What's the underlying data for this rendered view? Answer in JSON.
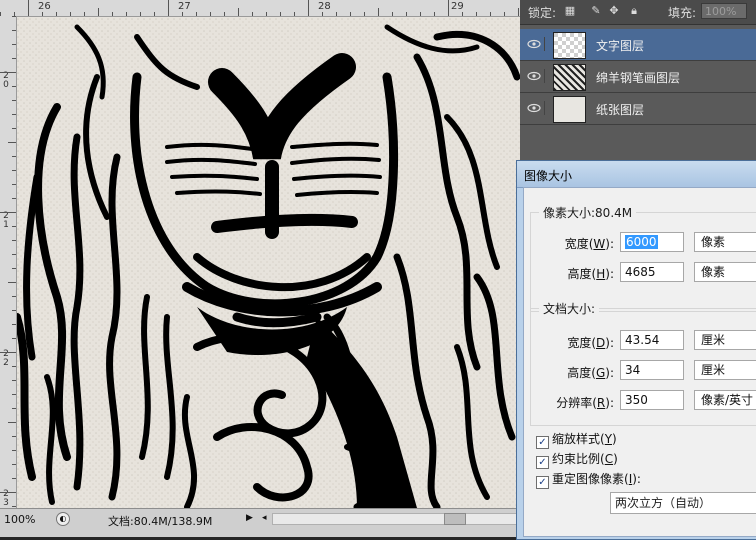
{
  "ruler": {
    "top_labels": [
      "26",
      "27",
      "28",
      "29"
    ],
    "left_labels": [
      [
        "2",
        "0"
      ],
      [
        "2",
        "1"
      ],
      [
        "2",
        "2"
      ],
      [
        "2",
        "3"
      ]
    ]
  },
  "status": {
    "zoom": "100%",
    "doc": "文档:80.4M/138.9M"
  },
  "layers_panel": {
    "lock_label": "锁定:",
    "fill_label": "填充:",
    "fill_value": "100%",
    "layers": [
      {
        "name": "文字图层",
        "selected": true
      },
      {
        "name": "绵羊钢笔画图层",
        "selected": false
      },
      {
        "name": "纸张图层",
        "selected": false
      }
    ]
  },
  "dialog": {
    "title": "图像大小",
    "pixel_group": {
      "legend": "像素大小:80.4M",
      "width_label": "宽度(",
      "width_key": "W",
      "width_value": "6000",
      "width_unit": "像素",
      "height_label": "高度(",
      "height_key": "H",
      "height_value": "4685",
      "height_unit": "像素"
    },
    "doc_group": {
      "legend": "文档大小:",
      "width_label": "宽度(",
      "width_key": "D",
      "width_value": "43.54",
      "width_unit": "厘米",
      "height_label": "高度(",
      "height_key": "G",
      "height_value": "34",
      "height_unit": "厘米",
      "res_label": "分辨率(",
      "res_key": "R",
      "res_value": "350",
      "res_unit": "像素/英寸"
    },
    "options": {
      "scale_styles": "缩放样式(",
      "scale_key": "Y",
      "constrain": "约束比例(",
      "constrain_key": "C",
      "resample": "重定图像像素(",
      "resample_key": "I"
    },
    "resample_method": "两次立方（自动）"
  }
}
